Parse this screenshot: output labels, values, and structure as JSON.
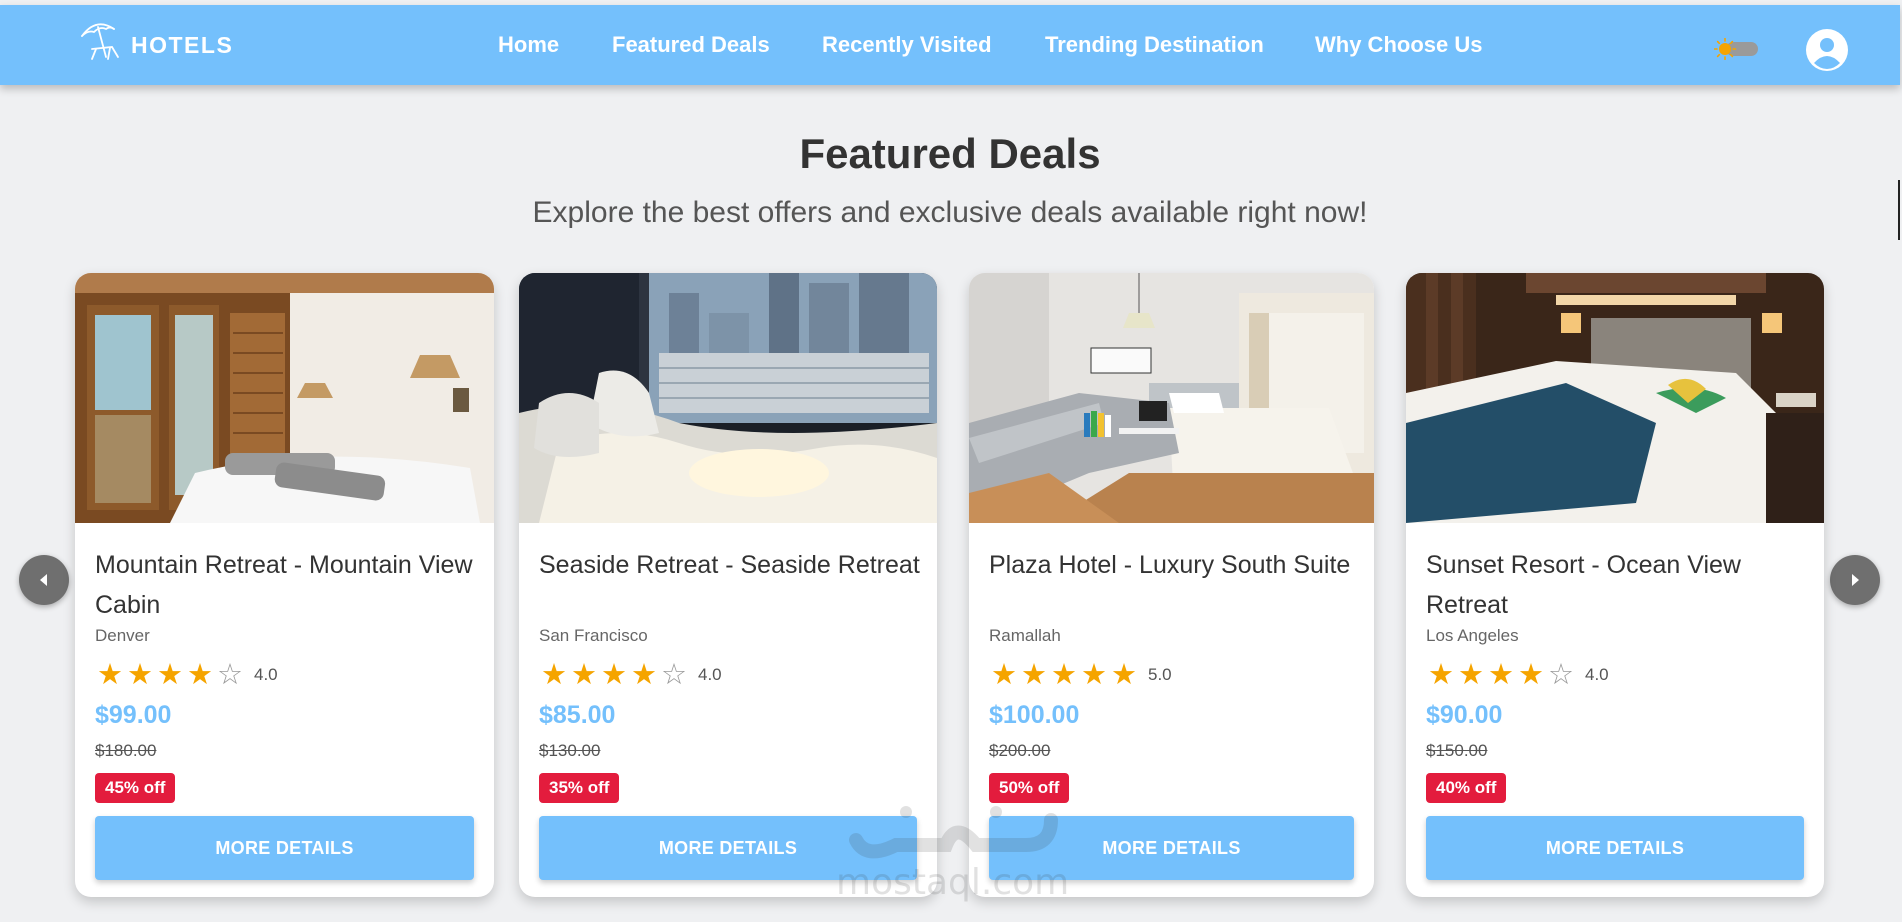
{
  "header": {
    "brand": "HOTELS",
    "nav": [
      "Home",
      "Featured Deals",
      "Recently Visited",
      "Trending Destination",
      "Why Choose Us"
    ]
  },
  "section": {
    "title": "Featured Deals",
    "subtitle": "Explore the best offers and exclusive deals available right now!"
  },
  "deals": [
    {
      "title": "Mountain Retreat - Mountain View Cabin",
      "city": "Denver",
      "rating": 4,
      "rating_label": "4.0",
      "price": "$99.00",
      "old_price": "$180.00",
      "discount": "45% off",
      "button": "MORE DETAILS"
    },
    {
      "title": "Seaside Retreat - Seaside Retreat",
      "city": "San Francisco",
      "rating": 4,
      "rating_label": "4.0",
      "price": "$85.00",
      "old_price": "$130.00",
      "discount": "35% off",
      "button": "MORE DETAILS"
    },
    {
      "title": "Plaza Hotel - Luxury South Suite",
      "city": "Ramallah",
      "rating": 5,
      "rating_label": "5.0",
      "price": "$100.00",
      "old_price": "$200.00",
      "discount": "50% off",
      "button": "MORE DETAILS"
    },
    {
      "title": "Sunset Resort - Ocean View Retreat",
      "city": "Los Angeles",
      "rating": 4,
      "rating_label": "4.0",
      "price": "$90.00",
      "old_price": "$150.00",
      "discount": "40% off",
      "button": "MORE DETAILS"
    }
  ],
  "watermark": {
    "url": "mostaql.com"
  },
  "colors": {
    "primary": "#74c0fc",
    "star": "#f5a400",
    "discount": "#e31c3d"
  },
  "icons": [
    "beach-umbrella-icon",
    "sun-icon",
    "user-avatar-icon",
    "chevron-left-icon",
    "chevron-right-icon",
    "star-icon"
  ]
}
